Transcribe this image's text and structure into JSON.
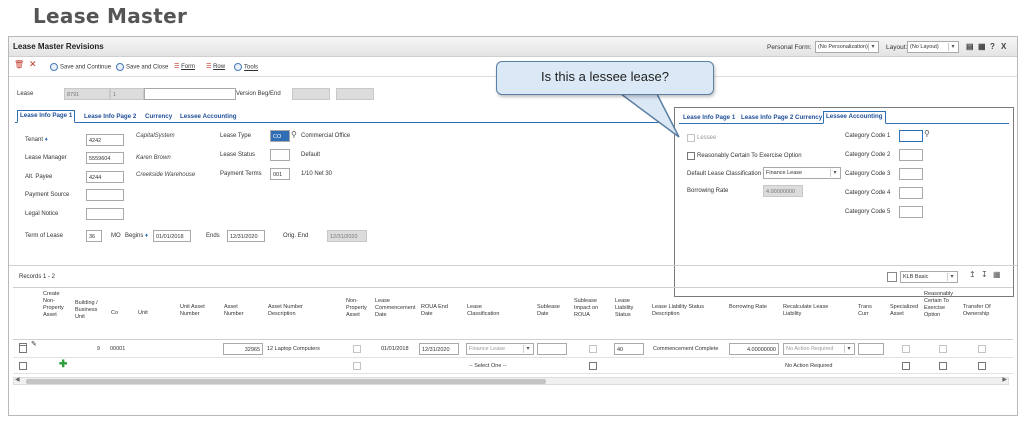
{
  "page_heading": "Lease Master",
  "window": {
    "title": "Lease Master Revisions",
    "personal_form_label": "Personal Form:",
    "personal_form_value": "(No Personalization)",
    "layout_label": "Layout:",
    "layout_value": "(No Layout)",
    "help_label": "?",
    "close_label": "X"
  },
  "toolbar": {
    "save_continue": "Save and Continue",
    "save_close": "Save and Close",
    "form": "Form",
    "row": "Row",
    "tools": "Tools"
  },
  "header": {
    "lease_label": "Lease",
    "lease_number": "8791",
    "lease_suffix": "1",
    "version_label": "Version Beg/End"
  },
  "tabs": [
    "Lease Info Page 1",
    "Lease Info Page 2",
    "Currency",
    "Lessee Accounting"
  ],
  "form": {
    "tenant_label": "Tenant",
    "tenant_value": "4242",
    "tenant_name": "CapitalSystem",
    "manager_label": "Lease Manager",
    "manager_value": "5559604",
    "manager_name": "Karen Brown",
    "payee_label": "Alt. Payee",
    "payee_value": "4244",
    "payee_name": "Creekside Warehouse",
    "payment_source_label": "Payment Source",
    "legal_notice_label": "Legal Notice",
    "lease_type_label": "Lease Type",
    "lease_type_code": "CO",
    "lease_type_desc": "Commercial Office",
    "lease_status_label": "Lease Status",
    "lease_status_desc": "Default",
    "payment_terms_label": "Payment Terms",
    "payment_terms_value": "001",
    "payment_terms_desc": "1/10 Net 30",
    "term_label": "Term of Lease",
    "term_value": "36",
    "term_unit": "MO",
    "begins_label": "Begins",
    "begins_value": "01/01/2018",
    "ends_label": "Ends",
    "ends_value": "12/31/2020",
    "orig_end_label": "Orig. End",
    "orig_end_value": "12/31/2020"
  },
  "overlay": {
    "tabs": [
      "Lease Info Page 1",
      "Lease Info Page 2",
      "Currency",
      "Lessee Accounting"
    ],
    "lessee_label": "Lessee",
    "reasonably_certain_label": "Reasonably Certain To Exercise Option",
    "default_class_label": "Default Lease Classification",
    "default_class_value": "Finance Lease",
    "borrowing_rate_label": "Borrowing Rate",
    "borrowing_rate_value": "4.00000000",
    "category_codes": [
      "Category Code 1",
      "Category Code 2",
      "Category Code 3",
      "Category Code 4",
      "Category Code 5"
    ]
  },
  "callout": {
    "text": "Is this a lessee lease?"
  },
  "grid": {
    "records_label": "Records 1 - 2",
    "format_value": "KLB Basic",
    "columns": [
      "Create Non-Property Asset",
      "Building / Business Unit",
      "Co",
      "Unit",
      "Unit Asset Number",
      "Asset Number",
      "Asset Number Description",
      "Non-Property Asset",
      "Lease Commencement Date",
      "ROUA End Date",
      "Lease Classification",
      "Sublease Date",
      "Sublease Impact on ROUA",
      "Lease Liability Status",
      "Lease Liability Status Description",
      "Borrowing Rate",
      "Recalculate Lease Liability",
      "Trans Curr",
      "Specialized Asset",
      "Reasonably Certain To Exercise Option",
      "Transfer Of Ownership"
    ],
    "row1": {
      "business_unit": "9",
      "company": "00001",
      "asset_number": "32965",
      "asset_desc": "12 Laptop Computers",
      "commencement": "01/01/2018",
      "roua_end": "12/31/2020",
      "classification": "Finance Lease",
      "liability_status": "40",
      "liability_desc": "Commencement Complete",
      "borrowing_rate": "4.00000000",
      "recalculate": "No Action Required"
    },
    "row2": {
      "classification": "-- Select One --",
      "recalculate": "No Action Required"
    }
  }
}
